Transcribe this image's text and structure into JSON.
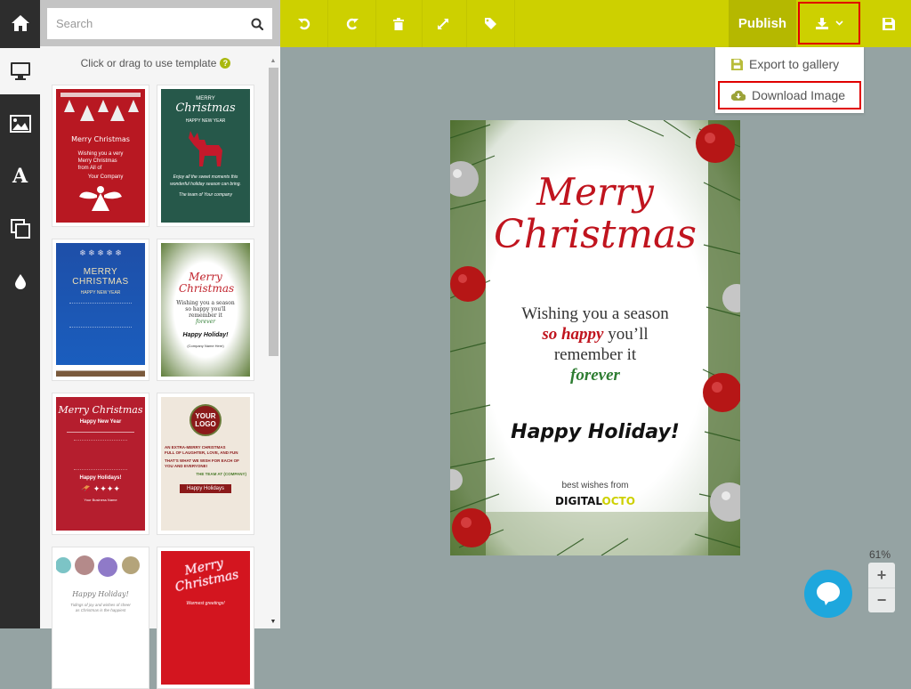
{
  "search": {
    "placeholder": "Search"
  },
  "panel": {
    "hint": "Click or drag to use template",
    "help_icon": "?"
  },
  "rail": {
    "items": [
      {
        "name": "home",
        "icon": "home-icon"
      },
      {
        "name": "templates",
        "icon": "monitor-icon",
        "active": true
      },
      {
        "name": "images",
        "icon": "image-icon"
      },
      {
        "name": "text",
        "icon": "text-icon",
        "glyph": "A"
      },
      {
        "name": "layers",
        "icon": "layers-icon"
      },
      {
        "name": "colors",
        "icon": "droplet-icon"
      }
    ]
  },
  "templates": [
    {
      "id": "red-trees",
      "bg": "#b81822",
      "title": "Merry Christmas",
      "lines": [
        "Wishing you a very",
        "Merry Christmas",
        "from All of",
        "Your Company"
      ],
      "fg": "#ffffff"
    },
    {
      "id": "green-reindeer",
      "bg": "#26584a",
      "title": "Christmas",
      "pretitle": "MERRY",
      "subtitle": "HAPPY NEW YEAR",
      "lines": [
        "Enjoy all the sweet moments this",
        "wonderful holiday season can bring.",
        "The team of Your company"
      ],
      "fg": "#ffffff"
    },
    {
      "id": "blue-ornaments",
      "bg": "#1e4fa8",
      "title": "MERRY CHRISTMAS",
      "subtitle": "HAPPY NEW YEAR",
      "fg": "#f2e2b6"
    },
    {
      "id": "white-wreath",
      "bg": "#ffffff",
      "title": "Merry Christmas",
      "lines": [
        "Wishing you a season",
        "so happy you'll",
        "remember it",
        "forever"
      ],
      "footer": "Happy Holiday!",
      "company": "(Company Name Here)",
      "fg": "#c0222b"
    },
    {
      "id": "red-sleigh",
      "bg": "#b51e2e",
      "title": "Merry Christmas",
      "subtitle": "Happy New Year",
      "footer": "Happy Holidays!",
      "company": "Your Business Name",
      "fg": "#ffffff"
    },
    {
      "id": "logo-wood",
      "bg": "#efe7dc",
      "logo": "YOUR LOGO",
      "lines": [
        "AN EXTRA-MERRY CHRISTMAS",
        "FULL OF LAUGHTER, LOVE, AND FUN",
        "THAT'S WHAT WE WISH FOR EACH OF",
        "YOU AND EVERYONE!",
        "THE TEAM AT (COMPANY)"
      ],
      "footer": "Happy Holidays",
      "fg": "#8b1a1a"
    },
    {
      "id": "baubles",
      "bg": "#ffffff",
      "title": "Happy Holiday!",
      "lines": [
        "Tidings of joy and wishes of cheer",
        "as Christmas is the happiest"
      ],
      "fg": "#888888"
    },
    {
      "id": "red-script",
      "bg": "#d3151f",
      "title": "Merry Christmas",
      "lines": [
        "Warmest greetings!"
      ],
      "fg": "#ffffff"
    }
  ],
  "toolbar": {
    "undo": "undo-icon",
    "redo": "redo-icon",
    "delete": "trash-icon",
    "resize": "expand-icon",
    "tag": "tag-icon",
    "publish_label": "Publish",
    "download": "download-icon",
    "save": "save-icon"
  },
  "dropdown": {
    "items": [
      {
        "label": "Export to gallery",
        "icon": "save-icon"
      },
      {
        "label": "Download Image",
        "icon": "cloud-download-icon",
        "highlighted": true
      }
    ]
  },
  "card": {
    "title_line1": "Merry",
    "title_line2": "Christmas",
    "wish_line1": "Wishing you a season",
    "wish_emph": "so happy",
    "wish_line2_rest": " you’ll",
    "wish_line3": "remember it",
    "wish_line4": "forever",
    "greeting": "Happy Holiday!",
    "sign_off": "best wishes from",
    "brand_a": "DIGITAL",
    "brand_b": "OCTO"
  },
  "zoom": {
    "level": "61%",
    "plus": "+",
    "minus": "−"
  },
  "colors": {
    "accent": "#cdd000",
    "publish": "#b5b800",
    "highlight": "#e00000",
    "chat": "#1ea7dd",
    "title_red": "#c0141e",
    "forever_green": "#2e7d32"
  }
}
